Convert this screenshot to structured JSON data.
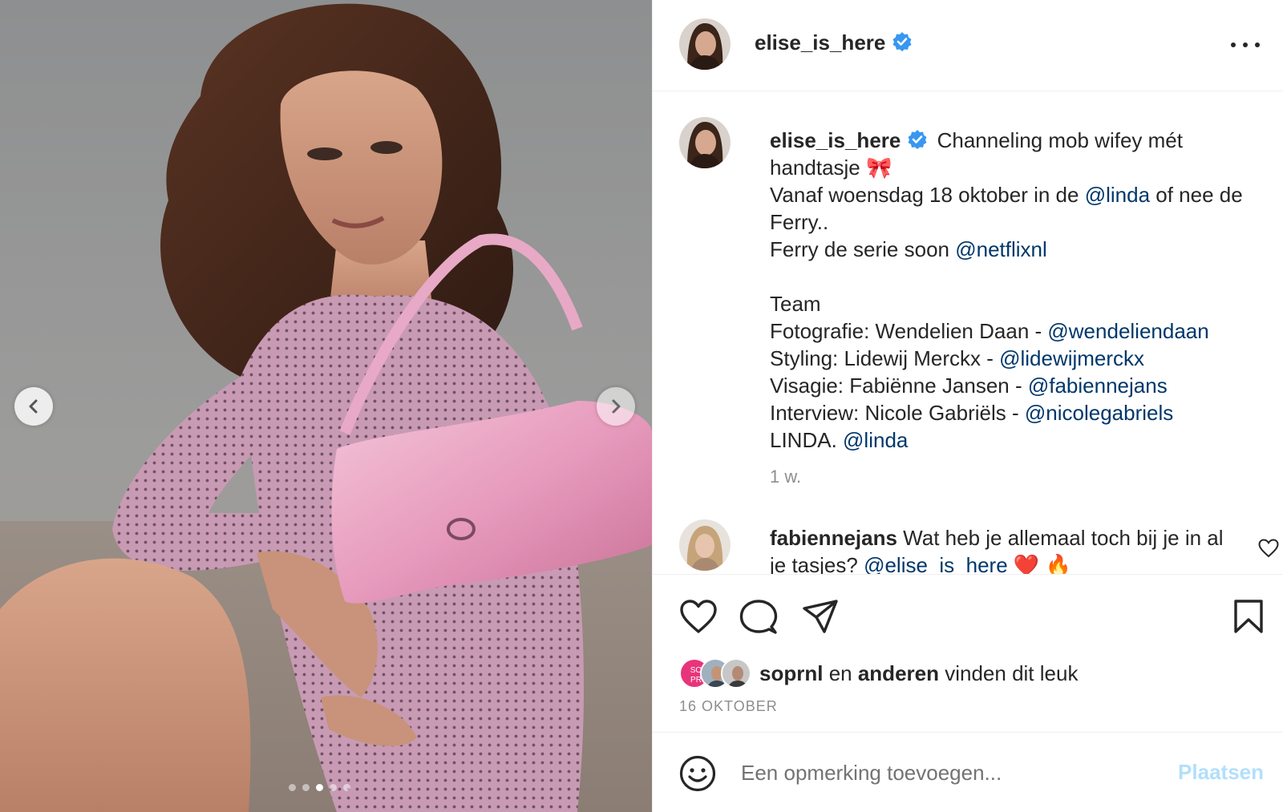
{
  "post": {
    "username": "elise_is_here",
    "caption": {
      "line1_text": "Channeling mob wifey mét handtasje 🎀",
      "line2_pre": "Vanaf woensdag 18 oktober in de ",
      "line2_link": "@linda",
      "line2_post": " of nee de Ferry..",
      "line3_pre": "Ferry de serie soon ",
      "line3_link": "@netflixnl",
      "team_heading": "Team",
      "credits": [
        {
          "label": "Fotografie: Wendelien Daan - ",
          "handle": "@wendeliendaan"
        },
        {
          "label": "Styling: Lidewij Merckx - ",
          "handle": "@lidewijmerckx"
        },
        {
          "label": "Visagie: Fabiënne Jansen - ",
          "handle": "@fabiennejans"
        },
        {
          "label": "Interview: Nicole Gabriëls - ",
          "handle": "@nicolegabriels"
        },
        {
          "label": "LINDA. ",
          "handle": "@linda"
        }
      ],
      "time": "1 w."
    },
    "comment": {
      "username": "fabiennejans",
      "text_pre": "Wat heb je allemaal toch bij je in al je tasjes? ",
      "mention": "@elise_is_here",
      "emojis": " ❤️ 🔥"
    },
    "likes": {
      "first_liker": "soprnl",
      "connector": "en",
      "others": "anderen",
      "suffix": "vinden dit leuk",
      "so_pr_badge": "SO\nPR"
    },
    "date": "16 OKTOBER",
    "comment_input": {
      "placeholder": "Een opmerking toevoegen...",
      "post_label": "Plaatsen"
    },
    "carousel": {
      "slides": 5,
      "active_index": 2
    }
  },
  "colors": {
    "link": "#00376b",
    "verified": "#3897f0",
    "muted": "#8e8e8e",
    "post_disabled": "#b2dffc",
    "badge_pink": "#e8347a"
  },
  "icons": [
    "chevron-left-icon",
    "chevron-right-icon",
    "verified-icon",
    "more-icon",
    "heart-icon",
    "comment-icon",
    "share-icon",
    "bookmark-icon",
    "emoji-icon"
  ]
}
